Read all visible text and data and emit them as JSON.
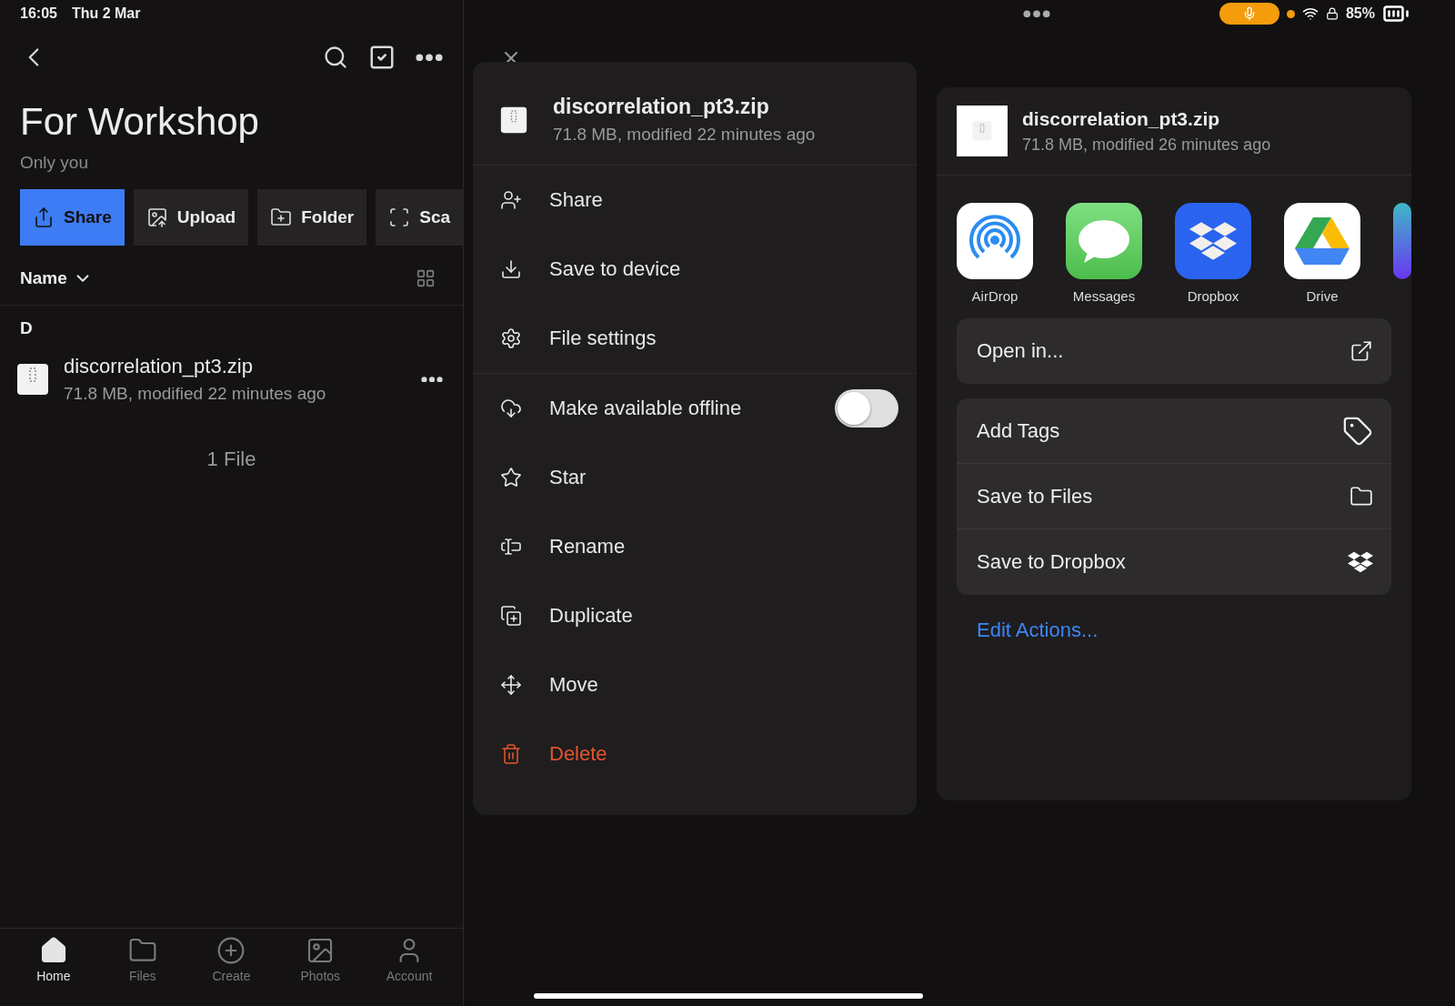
{
  "status_bar": {
    "time": "16:05",
    "date": "Thu 2 Mar",
    "battery": "85%",
    "recording": true
  },
  "folder": {
    "title": "For Workshop",
    "sharing": "Only you",
    "actions": [
      {
        "label": "Share",
        "kind": "primary"
      },
      {
        "label": "Upload",
        "kind": "secondary"
      },
      {
        "label": "Folder",
        "kind": "secondary"
      },
      {
        "label": "Sca",
        "kind": "secondary"
      }
    ],
    "sort": "Name",
    "section": "D",
    "files": [
      {
        "name": "discorrelation_pt3.zip",
        "meta": "71.8 MB, modified 22 minutes ago"
      }
    ],
    "count": "1 File"
  },
  "tab_bar": [
    {
      "label": "Home",
      "selected": true
    },
    {
      "label": "Files",
      "selected": false
    },
    {
      "label": "Create",
      "selected": false
    },
    {
      "label": "Photos",
      "selected": false
    },
    {
      "label": "Account",
      "selected": false
    }
  ],
  "file_menu": {
    "file": {
      "name": "discorrelation_pt3.zip",
      "meta": "71.8 MB, modified 22 minutes ago"
    },
    "sections": [
      [
        {
          "label": "Share",
          "kind": "action"
        },
        {
          "label": "Save to device",
          "kind": "action"
        },
        {
          "label": "File settings",
          "kind": "action"
        }
      ],
      [
        {
          "label": "Make available offline",
          "kind": "toggle",
          "on": false
        },
        {
          "label": "Star",
          "kind": "action"
        },
        {
          "label": "Rename",
          "kind": "action"
        },
        {
          "label": "Duplicate",
          "kind": "action"
        },
        {
          "label": "Move",
          "kind": "action"
        },
        {
          "label": "Delete",
          "kind": "destructive"
        }
      ]
    ]
  },
  "share_sheet": {
    "file": {
      "name": "discorrelation_pt3.zip",
      "meta": "71.8 MB, modified 26 minutes ago"
    },
    "apps": [
      {
        "label": "AirDrop"
      },
      {
        "label": "Messages"
      },
      {
        "label": "Dropbox"
      },
      {
        "label": "Drive"
      }
    ],
    "action_groups": [
      [
        {
          "label": "Open in..."
        }
      ],
      [
        {
          "label": "Add Tags"
        },
        {
          "label": "Save to Files"
        },
        {
          "label": "Save to Dropbox"
        }
      ]
    ],
    "edit_link": "Edit Actions..."
  }
}
